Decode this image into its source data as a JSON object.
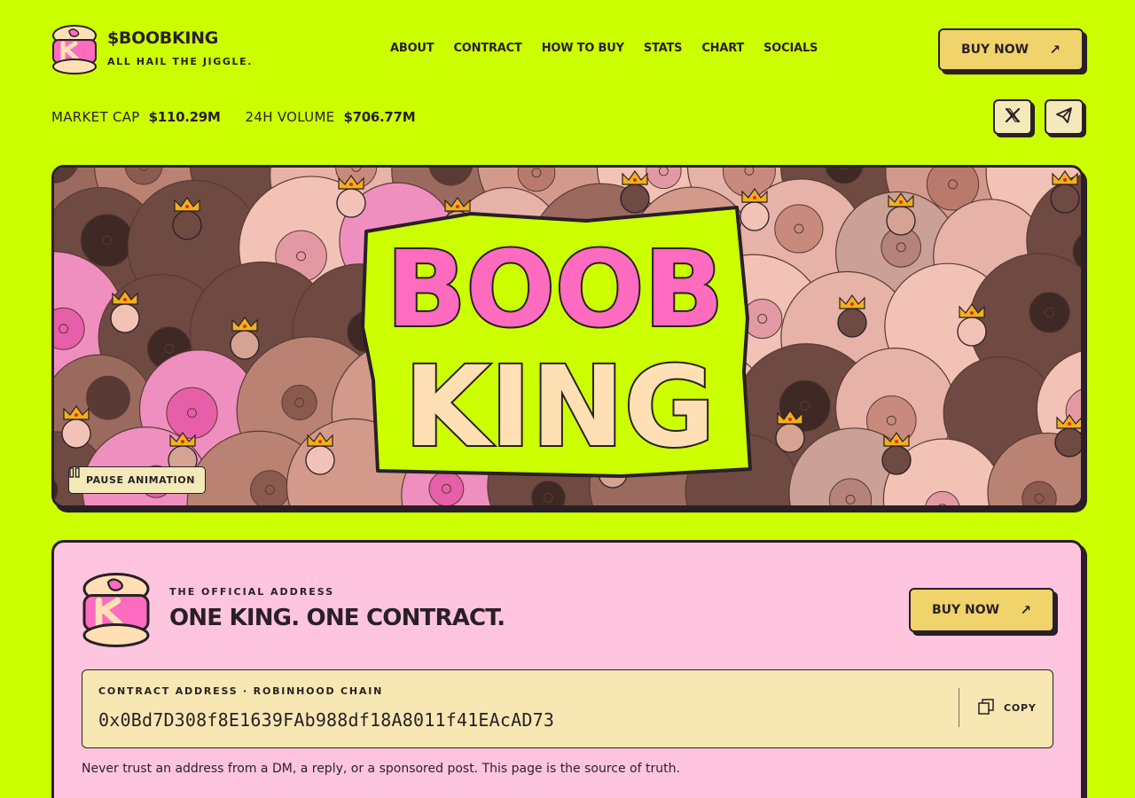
{
  "header": {
    "brand_name": "$BOOBKING",
    "tagline": "ALL HAIL THE JIGGLE.",
    "nav": [
      "ABOUT",
      "CONTRACT",
      "HOW TO BUY",
      "STATS",
      "CHART",
      "SOCIALS"
    ],
    "buy_label": "BUY NOW"
  },
  "stats": {
    "market_cap_label": "MARKET CAP",
    "market_cap_value": "$110.29M",
    "volume_label": "24H VOLUME",
    "volume_value": "$706.77M"
  },
  "socials": {
    "x_icon": "x-logo-icon",
    "telegram_icon": "telegram-icon"
  },
  "hero": {
    "title_line1": "BOOB",
    "title_line2": "KING",
    "pause_label": "PAUSE ANIMATION"
  },
  "contract": {
    "eyebrow": "THE OFFICIAL ADDRESS",
    "title": "ONE KING. ONE CONTRACT.",
    "buy_label": "BUY NOW",
    "address_label": "CONTRACT ADDRESS · ROBINHOOD CHAIN",
    "address": "0x0Bd7D308f8E1639FAb988df18A8011f41EAcAD73",
    "copy_label": "COPY",
    "warning": "Never trust an address from a DM, a reply, or a sponsored post. This page is the source of truth."
  },
  "colors": {
    "background": "#ccff00",
    "ink": "#2a1f26",
    "button": "#f0d36a",
    "card": "#ffc5de",
    "address_box": "#f7e7b3",
    "title_pink": "#ff6bbf",
    "title_cream": "#ffe0b5"
  }
}
